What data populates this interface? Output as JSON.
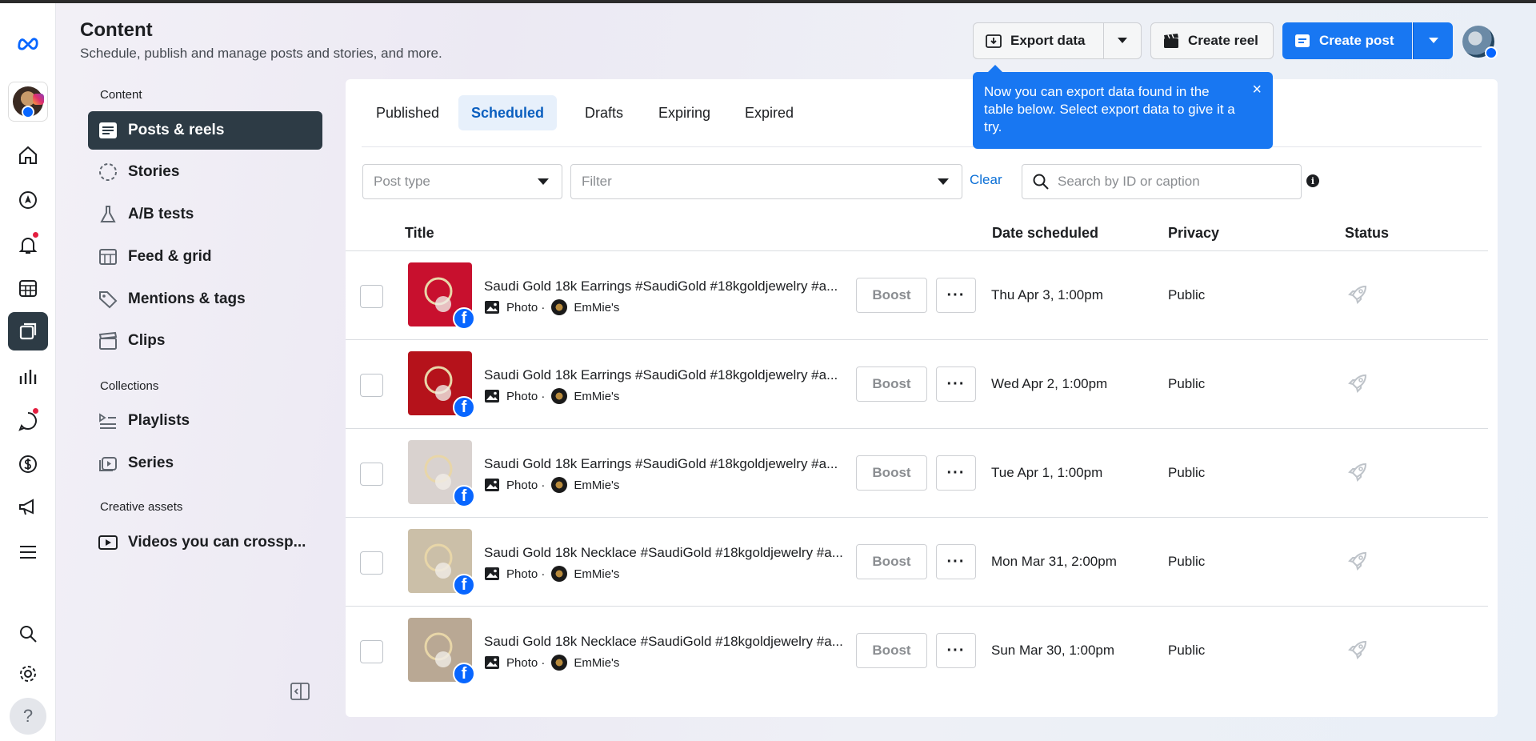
{
  "header": {
    "title": "Content",
    "subtitle": "Schedule, publish and manage posts and stories, and more.",
    "export_label": "Export data",
    "create_reel_label": "Create reel",
    "create_post_label": "Create post"
  },
  "tooltip": {
    "text": "Now you can export data found in the table below. Select export data to give it a try.",
    "close": "×"
  },
  "rail": {
    "icons": [
      "meta-logo-icon",
      "account-avatar",
      "home-icon",
      "compass-icon",
      "bell-icon",
      "calendar-grid-icon",
      "content-icon",
      "insights-icon",
      "inbox-icon",
      "monetization-icon",
      "ads-icon",
      "menu-icon",
      "search-icon",
      "settings-icon",
      "help-icon"
    ],
    "help_label": "?"
  },
  "sidebar": {
    "section_content": "Content",
    "section_collections": "Collections",
    "section_creative": "Creative assets",
    "items": [
      {
        "label": "Posts & reels",
        "icon": "posts-icon"
      },
      {
        "label": "Stories",
        "icon": "stories-icon"
      },
      {
        "label": "A/B tests",
        "icon": "flask-icon"
      },
      {
        "label": "Feed & grid",
        "icon": "feed-grid-icon"
      },
      {
        "label": "Mentions & tags",
        "icon": "tag-icon"
      },
      {
        "label": "Clips",
        "icon": "clapper-icon"
      },
      {
        "label": "Playlists",
        "icon": "playlist-icon"
      },
      {
        "label": "Series",
        "icon": "series-icon"
      },
      {
        "label": "Videos you can crossp...",
        "icon": "video-icon"
      }
    ]
  },
  "tabs": [
    {
      "label": "Published",
      "active": false
    },
    {
      "label": "Scheduled",
      "active": true
    },
    {
      "label": "Drafts",
      "active": false
    },
    {
      "label": "Expiring",
      "active": false
    },
    {
      "label": "Expired",
      "active": false
    }
  ],
  "filters": {
    "post_type_placeholder": "Post type",
    "filter_placeholder": "Filter",
    "clear_label": "Clear",
    "search_placeholder": "Search by ID or caption",
    "info": "i"
  },
  "table": {
    "headers": {
      "title": "Title",
      "date": "Date scheduled",
      "privacy": "Privacy",
      "status": "Status"
    },
    "boost_label": "Boost",
    "more_label": "···",
    "rows": [
      {
        "title": "Saudi Gold 18k Earrings #SaudiGold #18kgoldjewelry #a...",
        "type": "Photo ·",
        "page": "EmMie's",
        "date": "Thu Apr 3, 1:00pm",
        "privacy": "Public",
        "thumb_color": "#c8102e"
      },
      {
        "title": "Saudi Gold 18k Earrings #SaudiGold #18kgoldjewelry #a...",
        "type": "Photo ·",
        "page": "EmMie's",
        "date": "Wed Apr 2, 1:00pm",
        "privacy": "Public",
        "thumb_color": "#b5121b"
      },
      {
        "title": "Saudi Gold 18k Earrings #SaudiGold #18kgoldjewelry #a...",
        "type": "Photo ·",
        "page": "EmMie's",
        "date": "Tue Apr 1, 1:00pm",
        "privacy": "Public",
        "thumb_color": "#d9d2cf"
      },
      {
        "title": "Saudi Gold 18k Necklace #SaudiGold #18kgoldjewelry #a...",
        "type": "Photo ·",
        "page": "EmMie's",
        "date": "Mon Mar 31, 2:00pm",
        "privacy": "Public",
        "thumb_color": "#cbbfa8"
      },
      {
        "title": "Saudi Gold 18k Necklace #SaudiGold #18kgoldjewelry #a...",
        "type": "Photo ·",
        "page": "EmMie's",
        "date": "Sun Mar 30, 1:00pm",
        "privacy": "Public",
        "thumb_color": "#b9a894"
      }
    ]
  },
  "colors": {
    "accent": "#1877f2",
    "active_nav": "#2d3b45",
    "link": "#0b6fd6"
  }
}
